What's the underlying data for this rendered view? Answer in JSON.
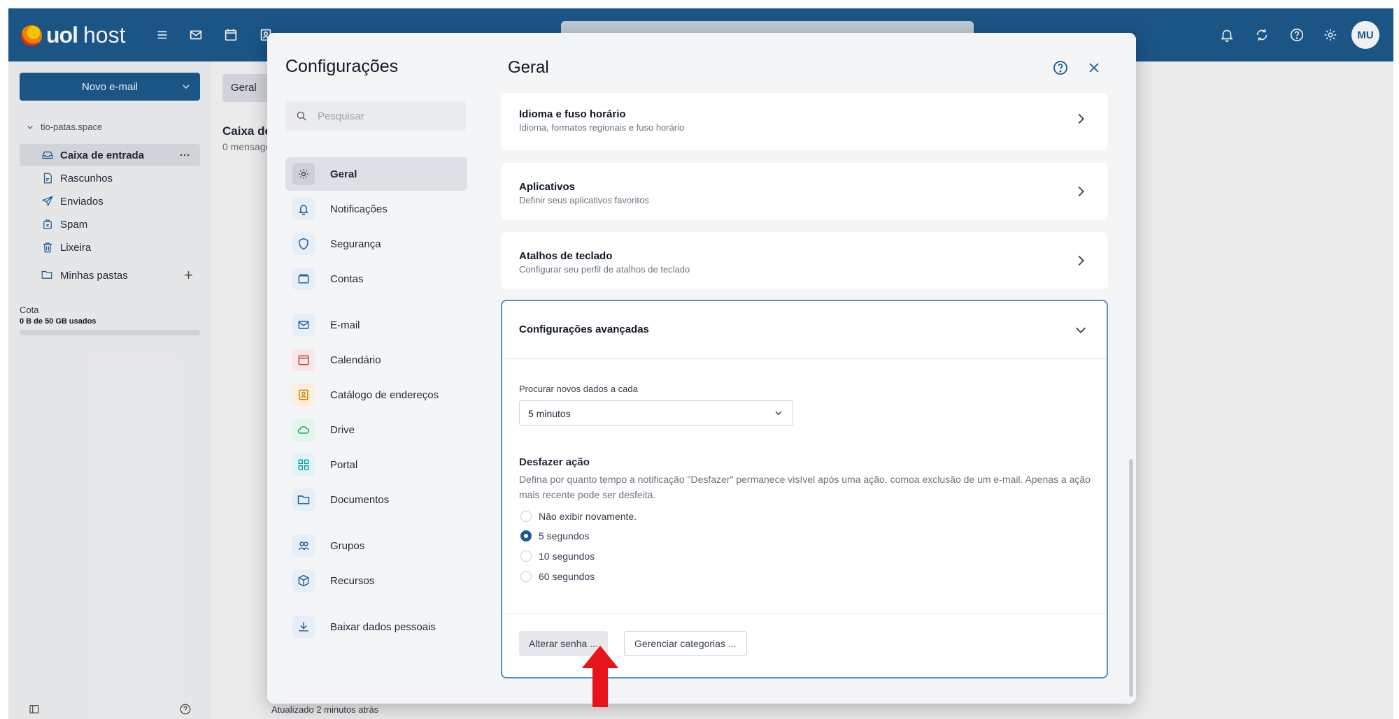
{
  "brand": {
    "uol": "uol",
    "host": "host"
  },
  "user": {
    "initials": "MU"
  },
  "sidebar": {
    "new_mail": "Novo e-mail",
    "account": "tio-patas.space",
    "folders": [
      {
        "label": "Caixa de entrada",
        "more": "···"
      },
      {
        "label": "Rascunhos"
      },
      {
        "label": "Enviados"
      },
      {
        "label": "Spam"
      },
      {
        "label": "Lixeira"
      }
    ],
    "my_folders": "Minhas pastas",
    "quota_label": "Cota",
    "quota_value": "0 B de 50 GB usados"
  },
  "list": {
    "chip": "Geral",
    "title": "Caixa de",
    "subtitle": "0 mensage",
    "updated": "Atualizado 2 minutos atrás"
  },
  "dialog": {
    "title": "Configurações",
    "search_placeholder": "Pesquisar",
    "nav": [
      {
        "label": "Geral",
        "icon": "gear-icon"
      },
      {
        "label": "Notificações",
        "icon": "bell-icon"
      },
      {
        "label": "Segurança",
        "icon": "shield-icon"
      },
      {
        "label": "Contas",
        "icon": "accounts-icon"
      },
      {
        "label": "E-mail",
        "icon": "mail-icon"
      },
      {
        "label": "Calendário",
        "icon": "calendar-icon"
      },
      {
        "label": "Catálogo de endereços",
        "icon": "contacts-icon"
      },
      {
        "label": "Drive",
        "icon": "cloud-icon"
      },
      {
        "label": "Portal",
        "icon": "grid-icon"
      },
      {
        "label": "Documentos",
        "icon": "folder-icon"
      },
      {
        "label": "Grupos",
        "icon": "groups-icon"
      },
      {
        "label": "Recursos",
        "icon": "cube-icon"
      },
      {
        "label": "Baixar dados pessoais",
        "icon": "download-icon"
      }
    ],
    "header": "Geral",
    "cards": [
      {
        "title": "Idioma e fuso horário",
        "subtitle": "Idioma, formatos regionais e fuso horário"
      },
      {
        "title": "Aplicativos",
        "subtitle": "Definir seus aplicativos favoritos"
      },
      {
        "title": "Atalhos de teclado",
        "subtitle": "Configurar seu perfil de atalhos de teclado"
      }
    ],
    "advanced": {
      "title": "Configurações avançadas",
      "fetch_label": "Procurar novos dados a cada",
      "fetch_value": "5 minutos",
      "undo_title": "Desfazer ação",
      "undo_desc": "Defina por quanto tempo a notificação \"Desfazer\" permanece visível após uma ação, comoa exclusão de um e-mail. Apenas a ação mais recente pode ser desfeita.",
      "options": [
        {
          "label": "Não exibir novamente.",
          "checked": false
        },
        {
          "label": "5 segundos",
          "checked": true
        },
        {
          "label": "10 segundos",
          "checked": false
        },
        {
          "label": "60 segundos",
          "checked": false
        }
      ],
      "change_password": "Alterar senha ...",
      "manage_categories": "Gerenciar categorias ..."
    }
  },
  "colors": {
    "brand_blue": "#1c5b8f",
    "accent_border": "#5b8fc2",
    "arrow_red": "#e8141c"
  }
}
